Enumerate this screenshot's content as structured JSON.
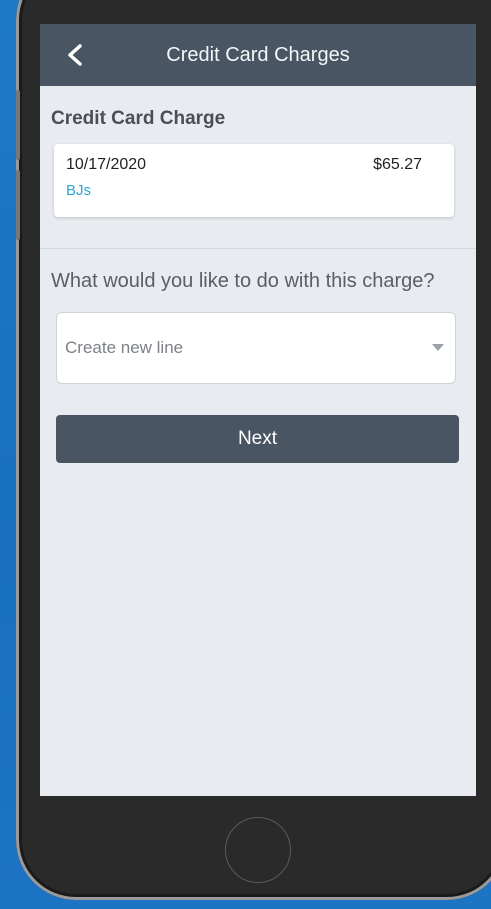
{
  "header": {
    "title": "Credit Card Charges",
    "back_icon": "chevron-left-icon"
  },
  "charge_section": {
    "title": "Credit Card Charge",
    "date": "10/17/2020",
    "amount": "$65.27",
    "merchant": "BJs"
  },
  "action": {
    "question": "What would you like to do with this charge?",
    "select_value": "Create new line",
    "next_label": "Next"
  },
  "colors": {
    "header_bg": "#4a5563",
    "screen_bg": "#e8ecf1",
    "merchant_link": "#2fa4d7",
    "button_bg": "#4a5563"
  }
}
